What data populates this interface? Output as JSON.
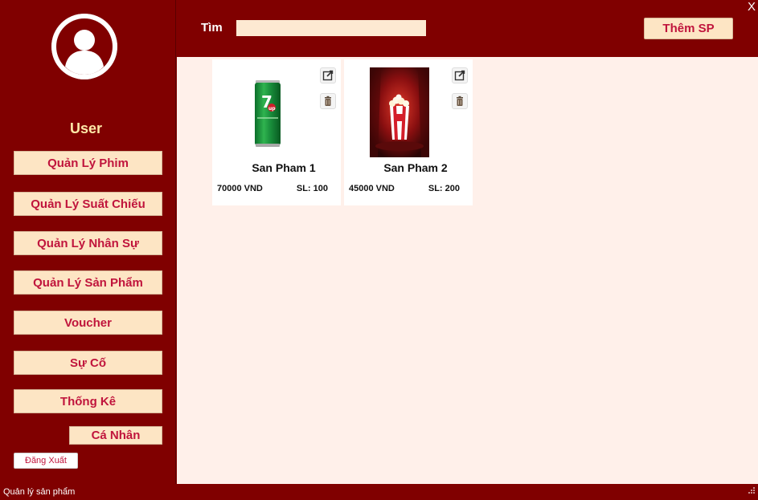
{
  "sidebar": {
    "user_label": "User",
    "menu": [
      {
        "label": "Quản Lý Phim"
      },
      {
        "label": "Quản Lý Suất Chiếu"
      },
      {
        "label": "Quản Lý Nhân Sự"
      },
      {
        "label": "Quản Lý Sản Phẩm"
      },
      {
        "label": "Voucher"
      },
      {
        "label": "Sự Cố"
      },
      {
        "label": "Thống Kê"
      },
      {
        "label": "Cá Nhân"
      }
    ],
    "logout_label": "Đăng Xuất"
  },
  "header": {
    "search_label": "Tìm",
    "search_value": "",
    "add_button_label": "Thêm SP",
    "close_label": "X"
  },
  "products": [
    {
      "name": "San Pham 1",
      "price": "70000 VND",
      "qty": "SL: 100",
      "image_icon": "7up-can-icon"
    },
    {
      "name": "San Pham 2",
      "price": "45000 VND",
      "qty": "SL: 200",
      "image_icon": "popcorn-icon"
    }
  ],
  "statusbar": {
    "text": "Quản lý sản phẩm"
  },
  "colors": {
    "primary": "#800000",
    "button_bg": "#fde5c4",
    "button_text": "#c0143c",
    "content_bg": "#fff0ea",
    "user_label": "#ffe9a8"
  }
}
